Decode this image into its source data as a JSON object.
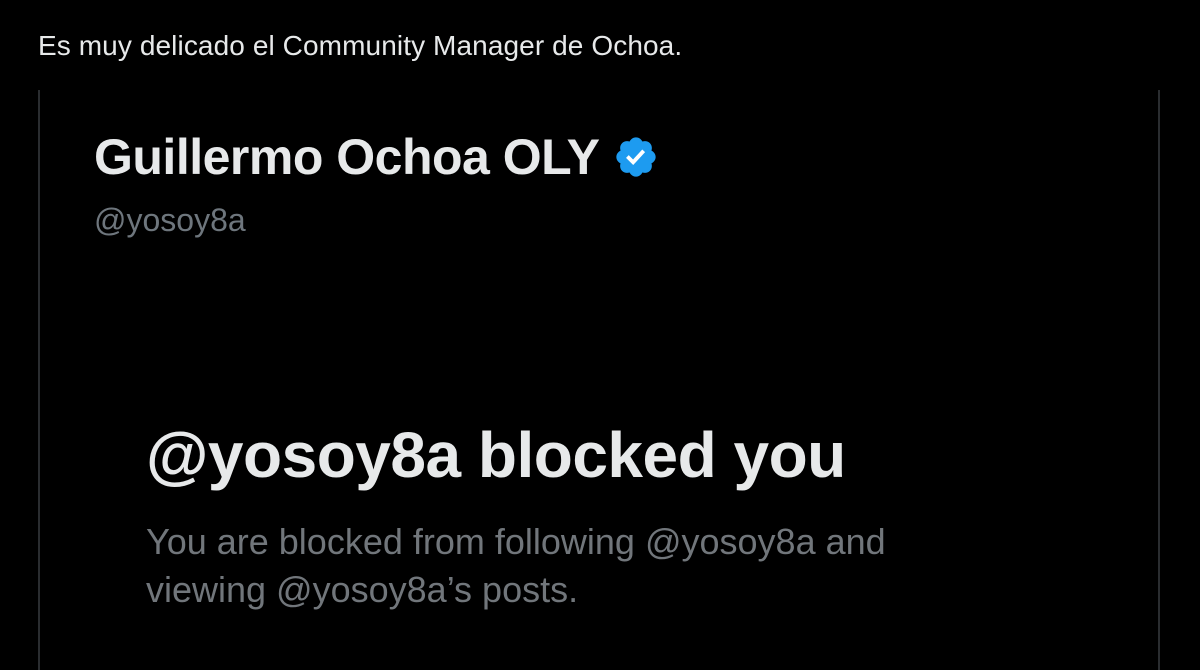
{
  "tweet": {
    "text": "Es muy delicado el Community Manager de Ochoa."
  },
  "embedded_profile": {
    "display_name": "Guillermo Ochoa OLY",
    "verified_icon": "verified-badge-icon",
    "handle": "@yosoy8a"
  },
  "blocked_notice": {
    "title": "@yosoy8a blocked you",
    "description_line1": "You are blocked from following @yosoy8a and",
    "description_line2": "viewing @yosoy8a’s posts."
  },
  "colors": {
    "background": "#000000",
    "primary_text": "#e7e9ea",
    "secondary_text": "#71767b",
    "verified_blue": "#1d9bf0",
    "border": "#2a2d30"
  }
}
